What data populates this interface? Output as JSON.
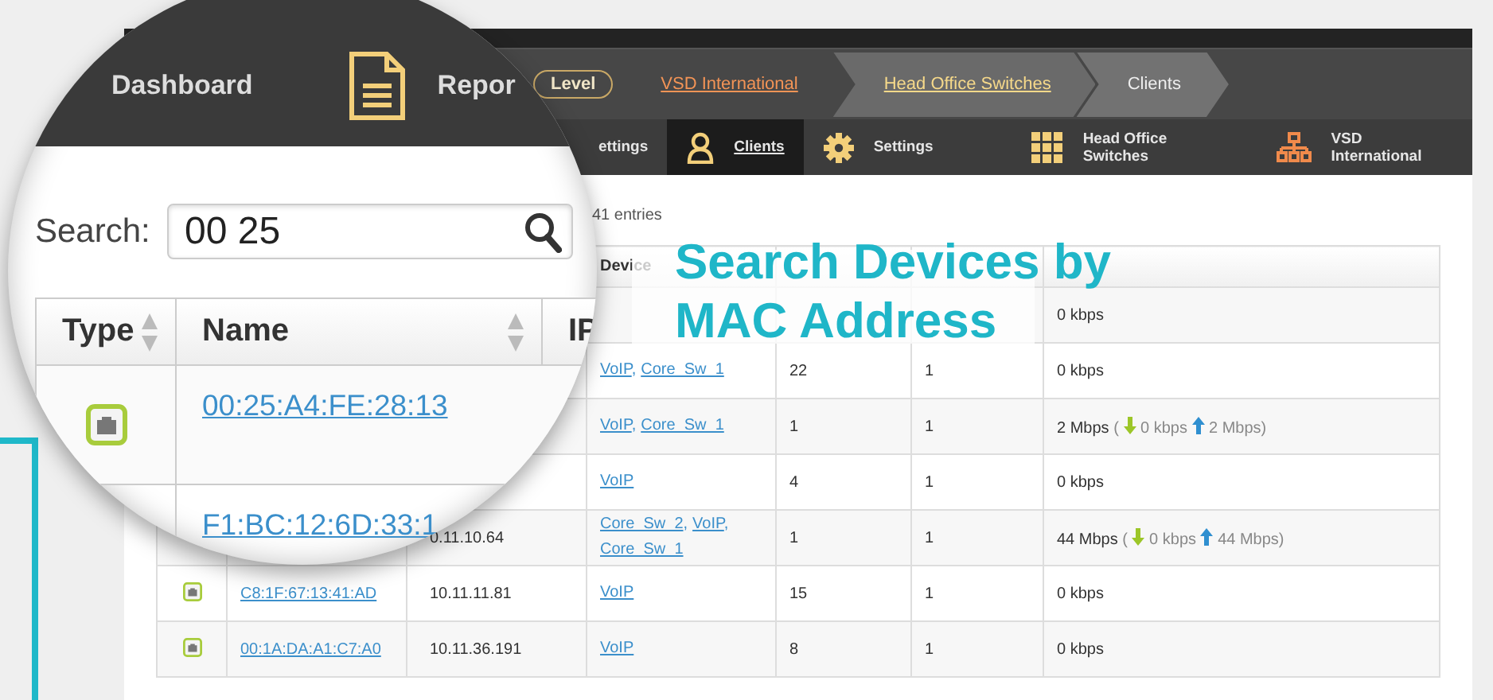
{
  "magnifier": {
    "nav": [
      {
        "label": "Dashboard",
        "kind": "text"
      },
      {
        "label": "Repor",
        "kind": "document"
      }
    ],
    "search": {
      "label": "Search:",
      "value": "00 25"
    },
    "columns": [
      "Type",
      "Name",
      "IP"
    ],
    "rows": [
      {
        "kind": "ethernet",
        "name": "00:25:A4:FE:28:13"
      },
      {
        "name": "F1:BC:12:6D:33:1"
      }
    ]
  },
  "breadcrumb": {
    "level_badge": "Level",
    "items": [
      {
        "label": "VSD International",
        "link": true
      },
      {
        "label": "Head Office Switches",
        "link": true
      },
      {
        "label": "Clients",
        "link": false
      }
    ]
  },
  "nav_tabs": [
    {
      "label": "ettings",
      "kind": "text",
      "selected": false
    },
    {
      "label": "Clients",
      "kind": "person",
      "selected": true
    },
    {
      "label": "Settings",
      "kind": "gear",
      "selected": false
    },
    {
      "label": "Head Office Switches",
      "kind": "grid",
      "selected": false
    },
    {
      "label": "VSD International",
      "kind": "hierarchy",
      "selected": false
    }
  ],
  "entries": "41 entries",
  "table": {
    "columns": [
      "Device"
    ],
    "rows": [
      {
        "traffic": "0 kbps"
      },
      {
        "devices": [
          {
            "name": "VoIP",
            "sep": ","
          },
          {
            "name": "Core_Sw_1"
          }
        ],
        "port": "22",
        "vlan": "1",
        "traffic": "0 kbps"
      },
      {
        "devices": [
          {
            "name": "VoIP",
            "sep": ","
          },
          {
            "name": "Core_Sw_1"
          }
        ],
        "port": "1",
        "vlan": "1",
        "traffic": "2 Mbps",
        "detail": {
          "open": "(",
          "down": "0 kbps",
          "up": "2 Mbps)"
        }
      },
      {
        "devices": [
          {
            "name": "VoIP"
          }
        ],
        "port": "4",
        "vlan": "1",
        "traffic": "0 kbps"
      },
      {
        "ip": "0.11.10.64",
        "devices": [
          {
            "name": "Core_Sw_2",
            "sep": ","
          },
          {
            "name": "VoIP",
            "sep": ","
          },
          {
            "name": "Core_Sw_1"
          }
        ],
        "port": "1",
        "vlan": "1",
        "traffic": "44 Mbps",
        "detail": {
          "open": "(",
          "down": "0 kbps",
          "up": "44 Mbps)"
        }
      },
      {
        "kind": "ethernet",
        "name": "C8:1F:67:13:41:AD",
        "ip": "10.11.11.81",
        "devices": [
          {
            "name": "VoIP"
          }
        ],
        "port": "15",
        "vlan": "1",
        "traffic": "0 kbps"
      },
      {
        "kind": "ethernet",
        "name": "00:1A:DA:A1:C7:A0",
        "ip": "10.11.36.191",
        "devices": [
          {
            "name": "VoIP"
          }
        ],
        "port": "8",
        "vlan": "1",
        "traffic": "0 kbps"
      }
    ]
  },
  "headline": [
    "Search Devices by",
    "MAC Address"
  ]
}
